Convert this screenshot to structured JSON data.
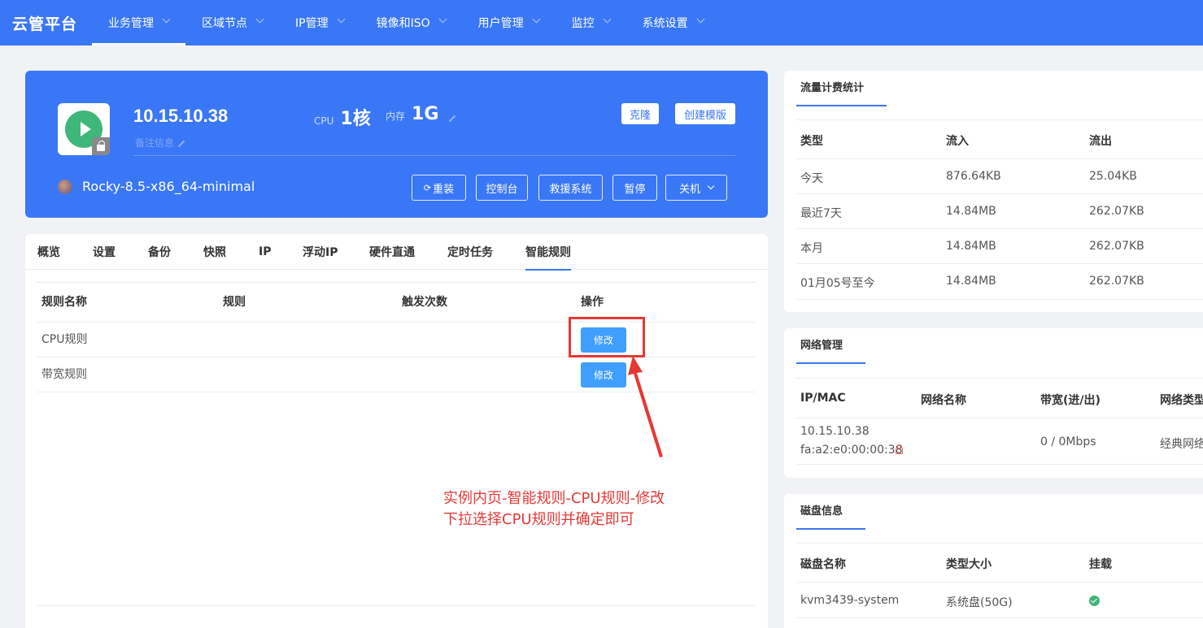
{
  "nav": {
    "brand": "云管平台",
    "items": [
      {
        "label": "业务管理"
      },
      {
        "label": "区域节点"
      },
      {
        "label": "IP管理"
      },
      {
        "label": "镜像和ISO"
      },
      {
        "label": "用户管理"
      },
      {
        "label": "监控"
      },
      {
        "label": "系统设置"
      }
    ]
  },
  "instance": {
    "ip": "10.15.10.38",
    "remark_placeholder": "备注信息",
    "cpu_label": "CPU",
    "cpu_value": "1核",
    "mem_label": "内存",
    "mem_value": "1G",
    "clone_label": "克隆",
    "create_template_label": "创建模版",
    "os_name": "Rocky-8.5-x86_64-minimal",
    "actions": {
      "reinstall": "重装",
      "console": "控制台",
      "rescue": "救援系统",
      "pause": "暂停",
      "shutdown": "关机"
    }
  },
  "tabs": [
    "概览",
    "设置",
    "备份",
    "快照",
    "IP",
    "浮动IP",
    "硬件直通",
    "定时任务",
    "智能规则"
  ],
  "rules_table": {
    "headers": [
      "规则名称",
      "规则",
      "触发次数",
      "操作"
    ],
    "rows": [
      {
        "name": "CPU规则",
        "rule": "",
        "count": "",
        "action": "修改"
      },
      {
        "name": "带宽规则",
        "rule": "",
        "count": "",
        "action": "修改"
      }
    ]
  },
  "annotation": {
    "line1": "实例内页-智能规则-CPU规则-修改",
    "line2": "下拉选择CPU规则并确定即可",
    "color": "#e53935"
  },
  "traffic": {
    "title": "流量计费统计",
    "headers": [
      "类型",
      "流入",
      "流出"
    ],
    "rows": [
      [
        "今天",
        "876.64KB",
        "25.04KB"
      ],
      [
        "最近7天",
        "14.84MB",
        "262.07KB"
      ],
      [
        "本月",
        "14.84MB",
        "262.07KB"
      ],
      [
        "01月05号至今",
        "14.84MB",
        "262.07KB"
      ]
    ]
  },
  "network": {
    "title": "网络管理",
    "headers": [
      "IP/MAC",
      "网络名称",
      "带宽(进/出)",
      "网络类型"
    ],
    "row": {
      "ip": "10.15.10.38",
      "mac": "fa:a2:e0:00:00:38",
      "name": "",
      "bandwidth": "0 / 0Mbps",
      "type": "经典网络"
    }
  },
  "disk": {
    "title": "磁盘信息",
    "headers": [
      "磁盘名称",
      "类型大小",
      "挂载"
    ],
    "row": {
      "name": "kvm3439-system",
      "type_size": "系统盘(50G)",
      "mounted_icon": "check-circle-icon"
    }
  },
  "colors": {
    "primary": "#3a77f6",
    "button": "#409eff",
    "success": "#3fb67a",
    "danger": "#e53935"
  }
}
